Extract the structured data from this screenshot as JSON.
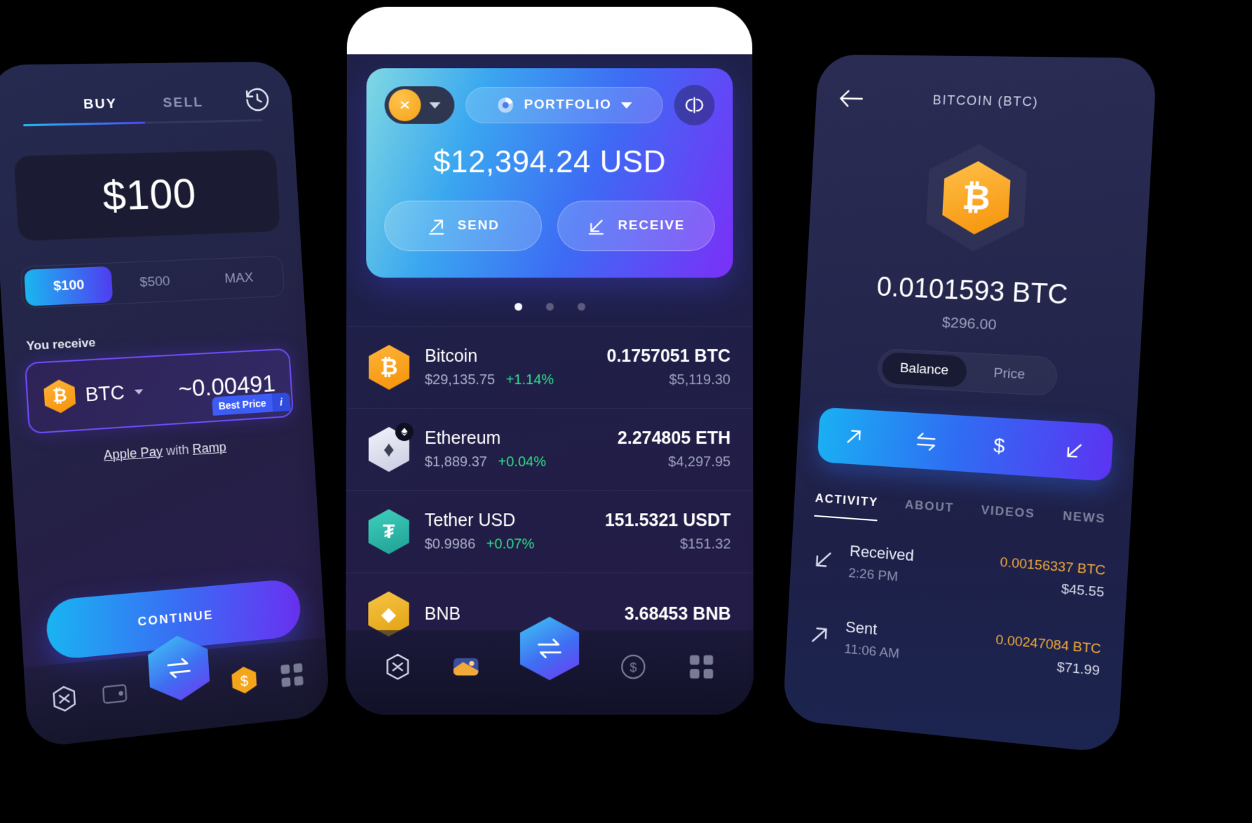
{
  "buy_screen": {
    "tabs": [
      {
        "label": "BUY",
        "active": true
      },
      {
        "label": "SELL",
        "active": false
      }
    ],
    "history_icon": "history-clock-icon",
    "amount_value": "$100",
    "presets": [
      {
        "label": "$100",
        "active": true
      },
      {
        "label": "$500",
        "active": false
      },
      {
        "label": "MAX",
        "active": false
      }
    ],
    "receive_label": "You receive",
    "best_price_badge": "Best Price",
    "best_price_info": "i",
    "receive_asset_symbol": "BTC",
    "receive_asset_icon": "bitcoin-hexagon-icon",
    "receive_amount": "~0.00491",
    "payment_prefix": "Apple Pay",
    "payment_middle": " with ",
    "payment_provider": "Ramp",
    "continue_label": "CONTINUE",
    "nav": [
      {
        "name": "exodus-logo-icon"
      },
      {
        "name": "wallet-icon"
      },
      {
        "name": "swap-arrows-icon"
      },
      {
        "name": "buy-coin-icon"
      },
      {
        "name": "apps-grid-icon"
      }
    ]
  },
  "portfolio_screen": {
    "wallet_icon": "exodus-coin-icon",
    "wallet_chevron": "chevron-down-icon",
    "portfolio_label": "PORTFOLIO",
    "portfolio_icon": "pie-chart-icon",
    "portfolio_chevron": "chevron-down-icon",
    "link_icon": "connect-link-icon",
    "total_balance": "$12,394.24 USD",
    "send_label": "SEND",
    "receive_label": "RECEIVE",
    "pagination": {
      "total": 3,
      "active_index": 0
    },
    "assets": [
      {
        "name": "Bitcoin",
        "icon": "bitcoin-hexagon-icon",
        "price": "$29,135.75",
        "change": "+1.14%",
        "quantity": "0.1757051 BTC",
        "fiat": "$5,119.30"
      },
      {
        "name": "Ethereum",
        "icon": "ethereum-hexagon-icon",
        "price": "$1,889.37",
        "change": "+0.04%",
        "quantity": "2.274805 ETH",
        "fiat": "$4,297.95"
      },
      {
        "name": "Tether USD",
        "icon": "tether-hexagon-icon",
        "price": "$0.9986",
        "change": "+0.07%",
        "quantity": "151.5321 USDT",
        "fiat": "$151.32"
      },
      {
        "name": "BNB",
        "icon": "bnb-hexagon-icon",
        "price": "",
        "change": "",
        "quantity": "3.68453 BNB",
        "fiat": ""
      }
    ],
    "nav": [
      {
        "name": "exodus-logo-icon"
      },
      {
        "name": "portfolio-icon"
      },
      {
        "name": "swap-arrows-icon"
      },
      {
        "name": "buy-coin-icon"
      },
      {
        "name": "apps-grid-icon"
      }
    ]
  },
  "asset_detail_screen": {
    "back_icon": "back-arrow-icon",
    "title": "BITCOIN (BTC)",
    "asset_icon": "bitcoin-hexagon-icon",
    "balance_crypto": "0.0101593 BTC",
    "balance_fiat": "$296.00",
    "toggle": [
      {
        "label": "Balance",
        "active": true
      },
      {
        "label": "Price",
        "active": false
      }
    ],
    "actions": [
      {
        "name": "send-arrow-icon"
      },
      {
        "name": "swap-arrows-icon"
      },
      {
        "name": "dollar-icon"
      },
      {
        "name": "receive-arrow-icon"
      }
    ],
    "tabs": [
      {
        "label": "ACTIVITY",
        "active": true
      },
      {
        "label": "ABOUT",
        "active": false
      },
      {
        "label": "VIDEOS",
        "active": false
      },
      {
        "label": "NEWS",
        "active": false
      }
    ],
    "transactions": [
      {
        "type": "Received",
        "icon": "receive-arrow-icon",
        "time": "2:26 PM",
        "amount": "0.00156337 BTC",
        "fiat": "$45.55"
      },
      {
        "type": "Sent",
        "icon": "send-arrow-icon",
        "time": "11:06 AM",
        "amount": "0.00247084 BTC",
        "fiat": "$71.99"
      }
    ]
  },
  "colors": {
    "accent_blue": "#19b5f2",
    "accent_purple": "#6a30f2",
    "positive_green": "#2ee08a",
    "bitcoin_orange": "#f5a315",
    "tether_teal": "#2bbfa8",
    "amount_orange": "#f0a93a"
  }
}
